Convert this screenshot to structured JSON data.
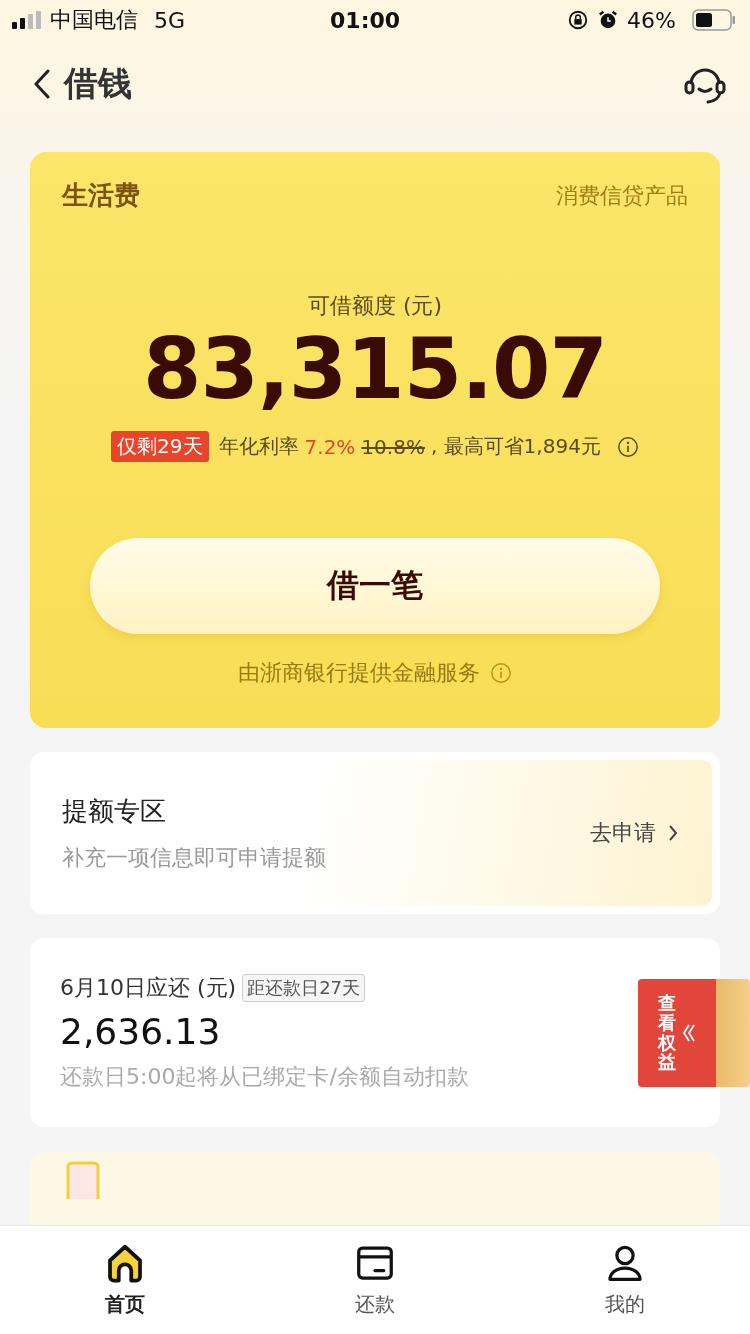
{
  "status_bar": {
    "carrier": "中国电信",
    "network": "5G",
    "time": "01:00",
    "battery": "46%"
  },
  "nav": {
    "title": "借钱"
  },
  "loan_card": {
    "name": "生活费",
    "tag": "消费信贷产品",
    "limit_label": "可借额度 (元)",
    "limit": "83,315.07",
    "badge": "仅剩29天",
    "rate_label": "年化利率",
    "rate_current": "7.2%",
    "rate_original": "10.8%",
    "savings": ", 最高可省1,894元",
    "button": "借一笔",
    "provider": "由浙商银行提供金融服务"
  },
  "raise_card": {
    "title": "提额专区",
    "subtitle": "补充一项信息即可申请提额",
    "action": "去申请"
  },
  "repay_card": {
    "title": "6月10日应还 (元)",
    "days_left": "距还款日27天",
    "amount": "2,636.13",
    "note": "还款日5:00起将从已绑定卡/余额自动扣款",
    "promo": "查看权益"
  },
  "tabs": [
    {
      "label": "首页",
      "kind": "home",
      "selected": true
    },
    {
      "label": "还款",
      "kind": "card",
      "selected": false
    },
    {
      "label": "我的",
      "kind": "person",
      "selected": false
    }
  ]
}
